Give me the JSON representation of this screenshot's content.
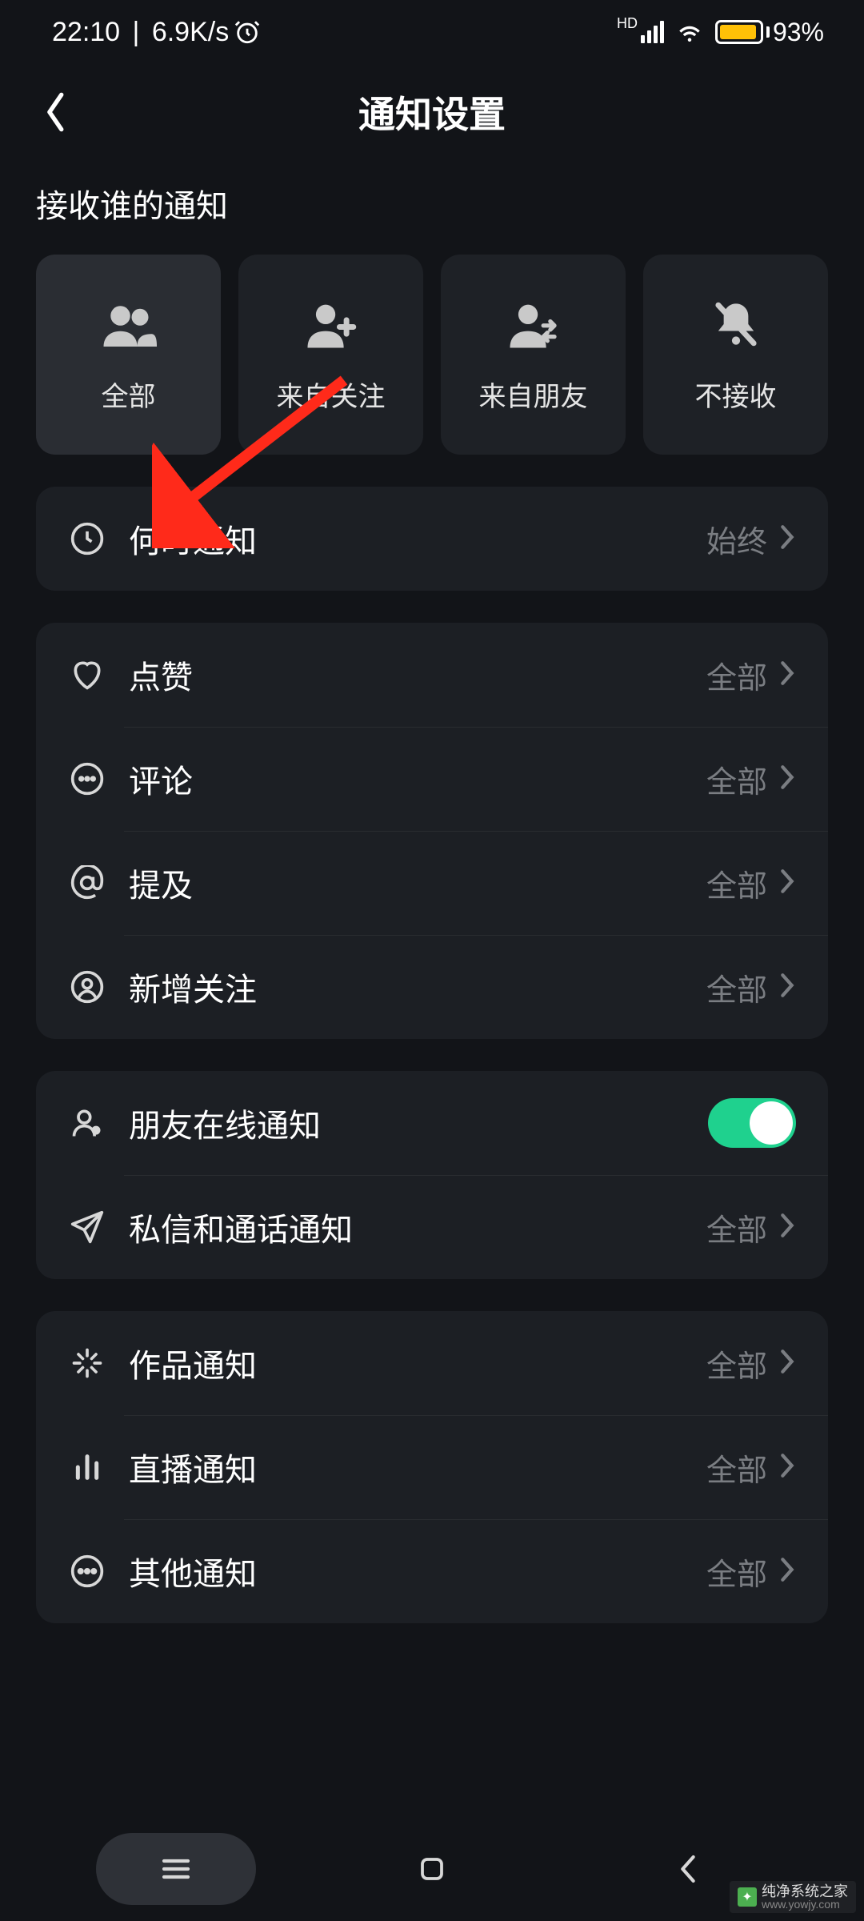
{
  "status": {
    "time": "22:10",
    "speed": "6.9K/s",
    "network_badge": "HD",
    "battery_percent": "93%"
  },
  "header": {
    "title": "通知设置"
  },
  "section_who_label": "接收谁的通知",
  "choices": [
    {
      "label": "全部",
      "icon": "people-icon"
    },
    {
      "label": "来自关注",
      "icon": "person-add-icon"
    },
    {
      "label": "来自朋友",
      "icon": "person-swap-icon"
    },
    {
      "label": "不接收",
      "icon": "bell-off-icon"
    }
  ],
  "group_when": {
    "items": [
      {
        "label": "何时通知",
        "value": "始终",
        "icon": "clock-icon"
      }
    ]
  },
  "group_interactions": {
    "items": [
      {
        "label": "点赞",
        "value": "全部",
        "icon": "heart-icon"
      },
      {
        "label": "评论",
        "value": "全部",
        "icon": "comment-icon"
      },
      {
        "label": "提及",
        "value": "全部",
        "icon": "at-icon"
      },
      {
        "label": "新增关注",
        "value": "全部",
        "icon": "user-circle-icon"
      }
    ]
  },
  "group_social": {
    "items": [
      {
        "label": "朋友在线通知",
        "type": "toggle",
        "on": true,
        "icon": "person-status-icon"
      },
      {
        "label": "私信和通话通知",
        "value": "全部",
        "icon": "send-icon"
      }
    ]
  },
  "group_content": {
    "items": [
      {
        "label": "作品通知",
        "value": "全部",
        "icon": "sparkle-icon"
      },
      {
        "label": "直播通知",
        "value": "全部",
        "icon": "bars-icon"
      },
      {
        "label": "其他通知",
        "value": "全部",
        "icon": "dots-icon"
      }
    ]
  },
  "watermark": {
    "name": "纯净系统之家",
    "url": "www.yowjy.com"
  }
}
